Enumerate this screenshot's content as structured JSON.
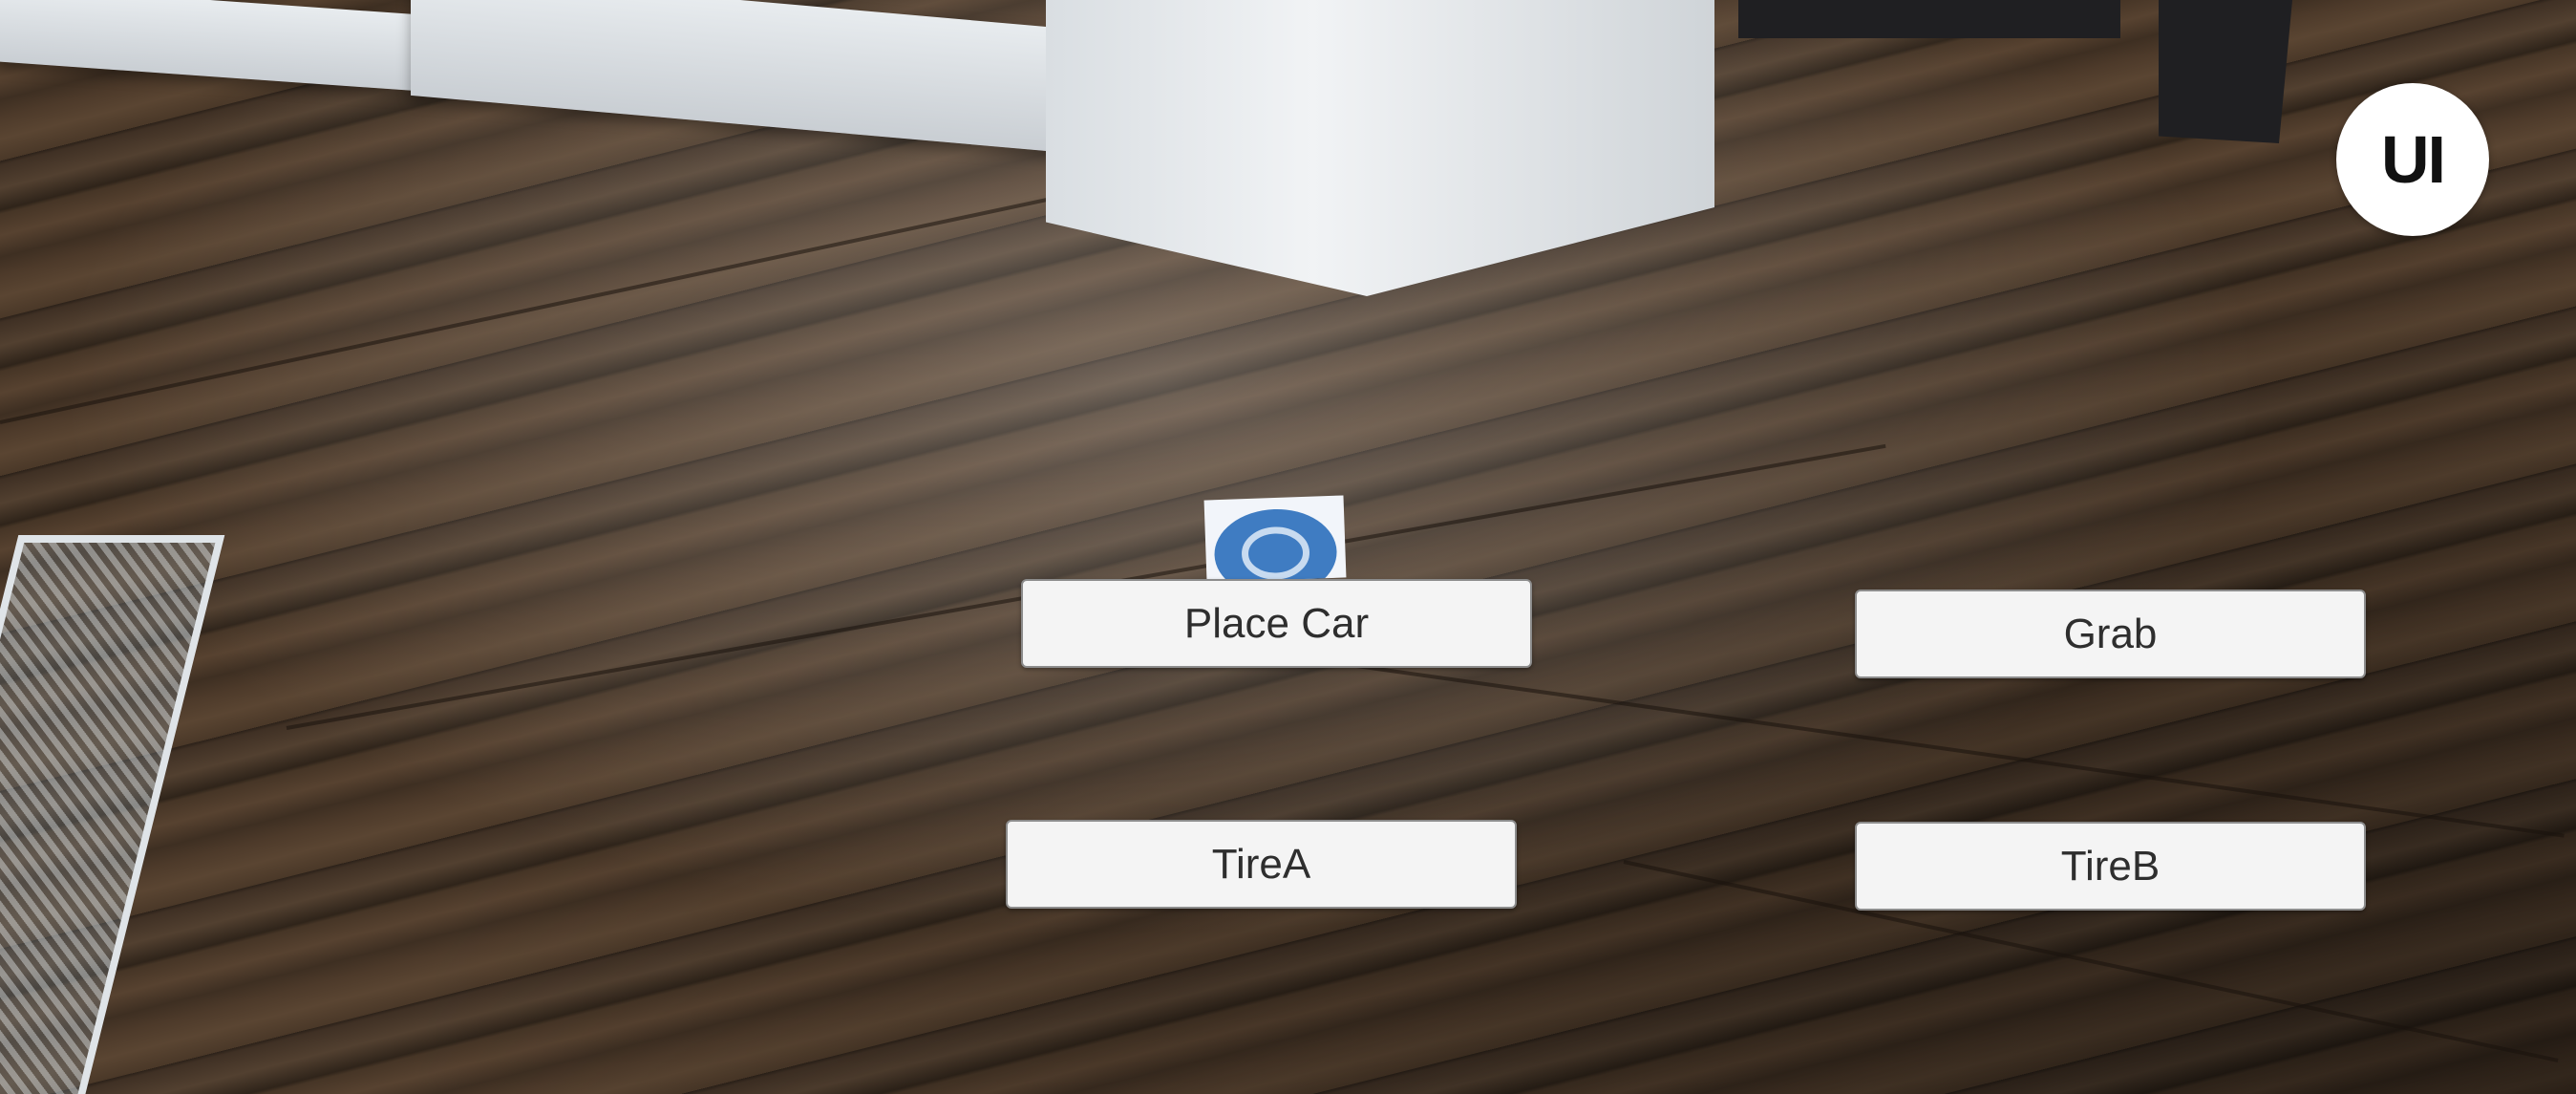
{
  "ui_toggle": {
    "label": "UI"
  },
  "buttons": {
    "place_car": "Place Car",
    "grab": "Grab",
    "tire_a": "TireA",
    "tire_b": "TireB"
  },
  "marker": {
    "icon": "placement-reticle-icon",
    "color": "#3f7cc2"
  },
  "colors": {
    "button_bg": "#f4f4f4",
    "button_text": "#2e2e2e",
    "floor": "#4a3828"
  }
}
